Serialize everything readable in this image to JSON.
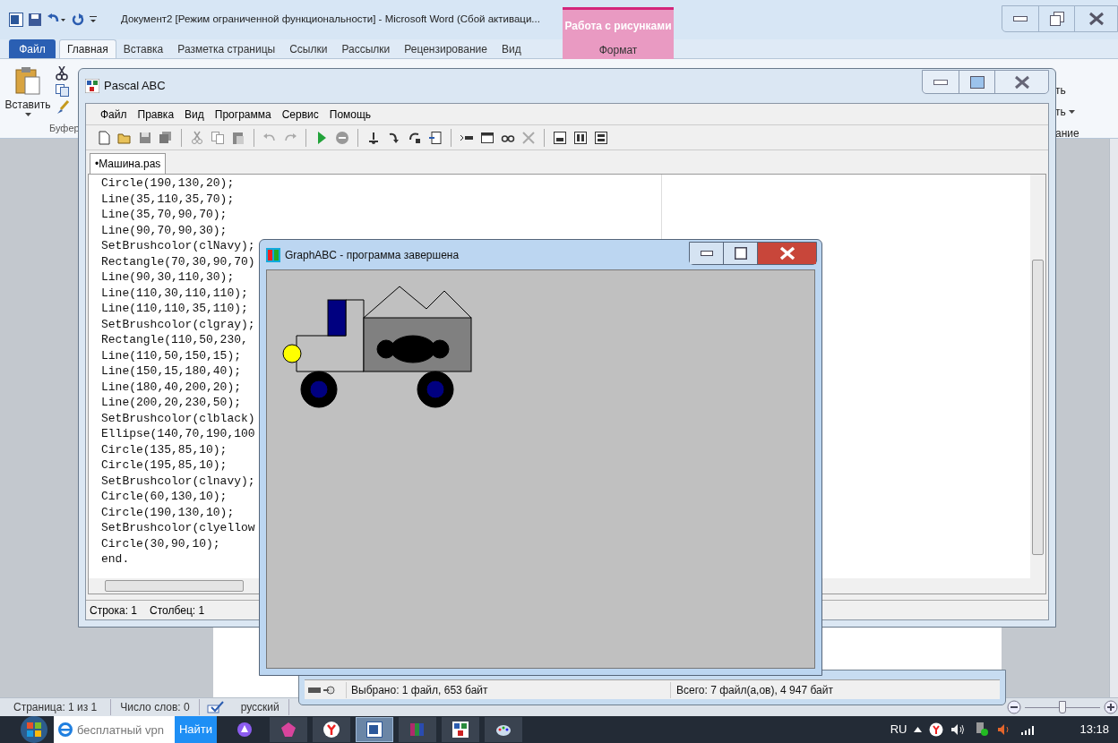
{
  "word": {
    "title": "Документ2 [Режим ограниченной функциональности]  -  Microsoft Word (Сбой активаци...",
    "context_tab": {
      "group": "Работа с рисунками",
      "label": "Формат",
      "selected": false
    },
    "file_button": "Файл",
    "tabs": [
      {
        "label": "Главная",
        "selected": true
      },
      {
        "label": "Вставка",
        "selected": false
      },
      {
        "label": "Разметка страницы",
        "selected": false
      },
      {
        "label": "Ссылки",
        "selected": false
      },
      {
        "label": "Рассылки",
        "selected": false
      },
      {
        "label": "Рецензирование",
        "selected": false
      },
      {
        "label": "Вид",
        "selected": false
      }
    ],
    "ribbon": {
      "paste_label": "Вставить",
      "group_label": "Буфер",
      "fragments": [
        "ть",
        "ть",
        "ание"
      ]
    },
    "status_bar": {
      "page": "Страница: 1 из 1",
      "words": "Число слов: 0",
      "language": "русский",
      "zoom_slider": {
        "level": 0.5
      }
    }
  },
  "pascal": {
    "title": "Pascal ABC",
    "menu": [
      "Файл",
      "Правка",
      "Вид",
      "Программа",
      "Сервис",
      "Помощь"
    ],
    "tabs": [
      {
        "label": "•Машина.pas",
        "selected": true
      }
    ],
    "code": [
      "Circle(190,130,20);",
      "Line(35,110,35,70);",
      "Line(35,70,90,70);",
      "Line(90,70,90,30);",
      "SetBrushcolor(clNavy);",
      "Rectangle(70,30,90,70)",
      "Line(90,30,110,30);",
      "Line(110,30,110,110);",
      "Line(110,110,35,110);",
      "SetBrushcolor(clgray);",
      "Rectangle(110,50,230,",
      "Line(110,50,150,15);",
      "Line(150,15,180,40);",
      "Line(180,40,200,20);",
      "Line(200,20,230,50);",
      "SetBrushcolor(clblack)",
      "Ellipse(140,70,190,100",
      "Circle(135,85,10);",
      "Circle(195,85,10);",
      "SetBrushcolor(clnavy);",
      "Circle(60,130,10);",
      "Circle(190,130,10);",
      "SetBrushcolor(clyellow",
      "Circle(30,90,10);",
      "end."
    ],
    "status_bar": [
      "Строка: 1",
      "Столбец: 1"
    ]
  },
  "graph_window": {
    "title": "GraphABC - программа завершена"
  },
  "explorer": {
    "selected_info": "Выбрано: 1 файл, 653 байт",
    "total_info": "Всего: 7 файл(а,ов), 4 947 байт"
  },
  "taskbar": {
    "search": {
      "value": "бесплатный vpn"
    },
    "search_button": "Найти",
    "language": "RU",
    "time": "13:18"
  }
}
